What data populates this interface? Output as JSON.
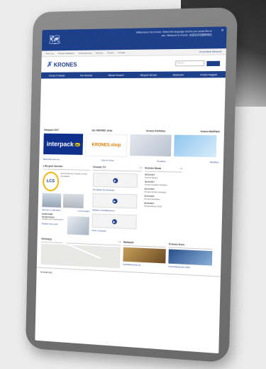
{
  "banner": {
    "text": "Willkommen bei Krones. Select the language version you would like to see. Welcome to Krones. 欢迎访问克朗斯网站",
    "close": "×"
  },
  "metanav": {
    "items": [
      "Über uns",
      "Investor Relations",
      "Verantwortung",
      "Karriere",
      "Presse",
      "Kontakt",
      "Kontakt"
    ],
    "region": "Deutschland (Deutsch)"
  },
  "header": {
    "logo_text": "KRONES",
    "search_placeholder": "Suche..."
  },
  "mainnav": [
    "Krones Produkte",
    "Ihre Branche",
    "Warum Krones?",
    "Lifecycle Service",
    "Newsroom",
    "Krones magazin"
  ],
  "promo": {
    "labels": [
      "interpack 2017",
      "Der KRONES .shop",
      "Krones Portfolios",
      "Krones MiniPlant"
    ],
    "interpack": "interpack",
    "interpack_badge": "the",
    "shop": "KRONES",
    "shop_suffix": ".shop",
    "captions": [
      "Besuchen Sie uns",
      "Jetzt im Shop",
      "Produkte",
      "MiniPlant"
    ]
  },
  "lifecycle": {
    "title": "Lifecycle Service",
    "lcs": "LCS",
    "text": "Krones Service Vorteile für Ihre Produktion",
    "links": [
      "Service im Überblick",
      "LCS Kunden"
    ],
    "box_title": "EVOGUARD Komponenten",
    "box_text": "Ventile und Komponenten",
    "box_link": "Erfahren Sie mehr"
  },
  "videos": {
    "title": "Krones TV",
    "captions": [
      "Die Marke für Getränke",
      "Abfüllen und Etikettieren",
      "Inline Lösungen"
    ]
  },
  "news": {
    "title": "Krones News",
    "items": [
      {
        "date": "28.04.2017",
        "text": "Krones Neues"
      },
      {
        "date": "26.04.2017",
        "text": "Krones erweitert Portfolio"
      },
      {
        "date": "25.04.2017",
        "text": "Krones auf der interpack"
      },
      {
        "date": "20.04.2017",
        "text": "Krones Neuheiten"
      },
      {
        "date": "18.04.2017",
        "text": "Krones Report 2016"
      }
    ]
  },
  "bottom": {
    "map_title": "Germany",
    "news2_title": "Weltweit",
    "news3_title": "Krones Kurs",
    "caption1": "Quartalsbericht Q1",
    "caption2": "Geschäftsbericht 2016",
    "footer": "Krones AG"
  }
}
